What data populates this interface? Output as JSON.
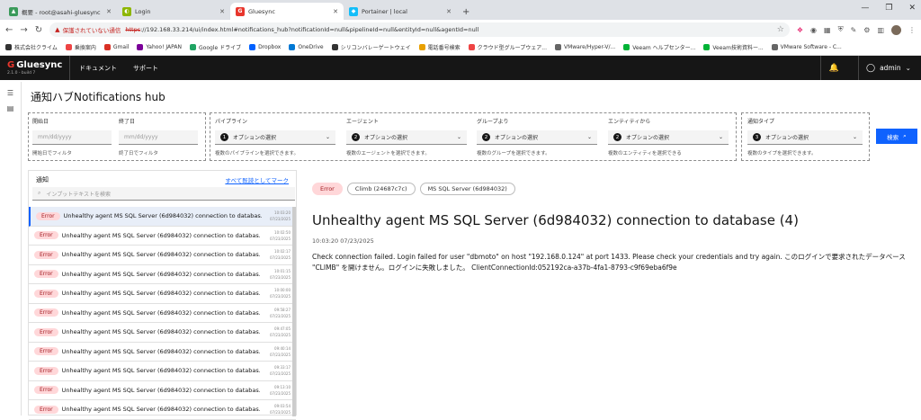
{
  "browser": {
    "tabs": [
      {
        "title": "概要 - root@asahi-gluesync",
        "fav_color": "#3a9a5a",
        "active": false
      },
      {
        "title": "Login",
        "fav_color": "#8db600",
        "active": false
      },
      {
        "title": "Gluesync",
        "fav_color": "#e8362d",
        "active": true
      },
      {
        "title": "Portainer | local",
        "fav_color": "#13bef9",
        "active": false
      }
    ],
    "insecure_label": "保護されていない通信",
    "url_scheme": "https",
    "url_rest": "://192.168.33.214/ui/index.html#notifications_hub?notificationId=null&pipelineId=null&entityId=null&agentId=null",
    "bookmarks": [
      {
        "label": "株式会社クライム",
        "color": "#333"
      },
      {
        "label": "乗換案内",
        "color": "#e44"
      },
      {
        "label": "Gmail",
        "color": "#d93025"
      },
      {
        "label": "Yahoo! JAPAN",
        "color": "#7b0099"
      },
      {
        "label": "Google ドライブ",
        "color": "#1fa463"
      },
      {
        "label": "Dropbox",
        "color": "#0061ff"
      },
      {
        "label": "OneDrive",
        "color": "#0078d4"
      },
      {
        "label": "シリコンバレーゲートウェイ",
        "color": "#333"
      },
      {
        "label": "電話番号検索",
        "color": "#e8a000"
      },
      {
        "label": "クラウド型グループウェア...",
        "color": "#e44"
      },
      {
        "label": "VMware/Hyper-V/...",
        "color": "#666"
      },
      {
        "label": "Veeam ヘルプセンター...",
        "color": "#00b336"
      },
      {
        "label": "Veeam技術資料ー...",
        "color": "#00b336"
      },
      {
        "label": "VMware Software - C...",
        "color": "#666"
      }
    ]
  },
  "app": {
    "brand": "Gluesync",
    "version": "2.1.0 - build 7",
    "menu": [
      "ドキュメント",
      "サポート"
    ],
    "user": "admin"
  },
  "page": {
    "title": "通知ハブNotifications hub"
  },
  "filters": {
    "start_label": "開始日",
    "start_placeholder": "mm/dd/yyyy",
    "start_help": "開始日でフィルタ",
    "end_label": "終了日",
    "end_placeholder": "mm/dd/yyyy",
    "end_help": "終了日でフィルタ",
    "pipeline_label": "パイプライン",
    "pipeline_help": "複数のパイプラインを選択できます。",
    "agent_label": "エージェント",
    "agent_help": "複数のエージェントを選択できます。",
    "group_label": "グループより",
    "group_help": "複数のグループを選択できます。",
    "entity_label": "エンティティから",
    "entity_help": "複数のエンティティを選択できる",
    "type_label": "通知タイプ",
    "type_help": "複数のタイプを選択できます。",
    "select_placeholder": "オプションの選択",
    "count_pipeline": "1",
    "count_agent": "2",
    "count_group": "2",
    "count_entity": "2",
    "count_type": "3",
    "search_button": "検索"
  },
  "notifications": {
    "header": "通知",
    "mark_all": "すべて既読としてマーク",
    "search_placeholder": "インプットテキストを検索",
    "items": [
      {
        "badge": "Error",
        "text": "Unhealthy agent MS SQL Server (6d984032) connection to databas...",
        "time": "10:03:20",
        "date": "07/23/2025"
      },
      {
        "badge": "Error",
        "text": "Unhealthy agent MS SQL Server (6d984032) connection to databas...",
        "time": "10:02:50",
        "date": "07/23/2025"
      },
      {
        "badge": "Error",
        "text": "Unhealthy agent MS SQL Server (6d984032) connection to databas...",
        "time": "10:02:17",
        "date": "07/23/2025"
      },
      {
        "badge": "Error",
        "text": "Unhealthy agent MS SQL Server (6d984032) connection to databas...",
        "time": "10:01:15",
        "date": "07/23/2025"
      },
      {
        "badge": "Error",
        "text": "Unhealthy agent MS SQL Server (6d984032) connection to databas...",
        "time": "10:00:00",
        "date": "07/23/2025"
      },
      {
        "badge": "Error",
        "text": "Unhealthy agent MS SQL Server (6d984032) connection to databas...",
        "time": "09:58:27",
        "date": "07/23/2025"
      },
      {
        "badge": "Error",
        "text": "Unhealthy agent MS SQL Server (6d984032) connection to databas...",
        "time": "09:47:05",
        "date": "07/23/2025"
      },
      {
        "badge": "Error",
        "text": "Unhealthy agent MS SQL Server (6d984032) connection to databas...",
        "time": "09:40:14",
        "date": "07/23/2025"
      },
      {
        "badge": "Error",
        "text": "Unhealthy agent MS SQL Server (6d984032) connection to databas...",
        "time": "09:33:17",
        "date": "07/23/2025"
      },
      {
        "badge": "Error",
        "text": "Unhealthy agent MS SQL Server (6d984032) connection to databas...",
        "time": "09:13:10",
        "date": "07/23/2025"
      },
      {
        "badge": "Error",
        "text": "Unhealthy agent MS SQL Server (6d984032) connection to databas...",
        "time": "09:03:54",
        "date": "07/23/2025"
      }
    ]
  },
  "detail": {
    "tags": [
      "Error",
      "Climb (24687c7c)",
      "MS SQL Server (6d984032)"
    ],
    "title": "Unhealthy agent MS SQL Server (6d984032) connection to database (4)",
    "timestamp": "10:03:20 07/23/2025",
    "body": "Check connection failed. Login failed for user \"dbmoto\" on host \"192.168.0.124\" at port 1433. Please check your credentials and try again. このログインで要求されたデータベース \"CLIMB\" を開けません。ログインに失敗しました。 ClientConnectionId:052192ca-a37b-4fa1-8793-c9f69eba6f9e"
  }
}
